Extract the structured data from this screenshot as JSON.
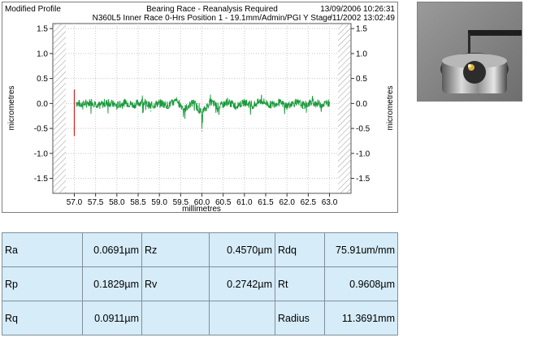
{
  "header": {
    "left": "Modified Profile",
    "center1": "Bearing Race - Reanalysis Required",
    "center2": "N360L5 Inner Race 0-Hrs Position 1 - 19.1mm/Admin/PGI Y Stage",
    "right1": "13/09/2006 10:26:31",
    "right2": "/11/2002 13:02:49"
  },
  "chart_data": {
    "type": "line",
    "title": "Bearing Race - Reanalysis Required",
    "subtitle": "N360L5 Inner Race 0-Hrs Position 1 - 19.1mm/Admin/PGI Y Stage",
    "xlabel": "millimetres",
    "ylabel": "micrometres",
    "xlim": [
      56.8,
      63.2
    ],
    "ylim": [
      -1.8,
      1.6
    ],
    "x_ticks": [
      "57.0",
      "57.5",
      "58.0",
      "58.5",
      "59.0",
      "59.5",
      "60.0",
      "60.5",
      "61.0",
      "61.5",
      "62.0",
      "62.5",
      "63.0"
    ],
    "y_ticks": [
      "1.5",
      "1.0",
      "0.5",
      "0.0",
      "-0.5",
      "-1.0",
      "-1.5"
    ],
    "grid": true,
    "series": [
      {
        "color": "#1a9a3c",
        "x": [
          57.05,
          57.2,
          57.4,
          57.6,
          57.8,
          58.0,
          58.2,
          58.4,
          58.6,
          58.8,
          59.0,
          59.2,
          59.4,
          59.6,
          59.8,
          60.0,
          60.2,
          60.4,
          60.6,
          60.8,
          61.0,
          61.2,
          61.4,
          61.6,
          61.8,
          62.0,
          62.2,
          62.4,
          62.6,
          62.8,
          63.0
        ],
        "y": [
          0.02,
          -0.05,
          0.08,
          -0.1,
          0.05,
          -0.12,
          0.06,
          -0.08,
          0.1,
          -0.15,
          0.04,
          -0.1,
          0.12,
          -0.3,
          0.06,
          -0.55,
          0.1,
          -0.2,
          0.08,
          -0.12,
          0.05,
          -0.1,
          0.15,
          -0.08,
          0.06,
          -0.12,
          0.05,
          -0.1,
          0.08,
          -0.05,
          0.03
        ]
      }
    ],
    "marker_x": 57.0,
    "marker_ylim": [
      -0.65,
      0.28
    ],
    "marker_color": "#d42020",
    "hatch_color": "#9a9a9a"
  },
  "photo": {
    "description_colors": [
      "#8a8a8a",
      "#2a2a2a",
      "#c8c8c8",
      "#e0b040"
    ]
  },
  "stats": {
    "rows": [
      [
        {
          "label": "Ra",
          "value": "0.0691µm"
        },
        {
          "label": "Rz",
          "value": "0.4570µm"
        },
        {
          "label": "Rdq",
          "value": "75.91um/mm"
        }
      ],
      [
        {
          "label": "Rp",
          "value": "0.1829µm"
        },
        {
          "label": "Rv",
          "value": "0.2742µm"
        },
        {
          "label": "Rt",
          "value": "0.9608µm"
        }
      ],
      [
        {
          "label": "Rq",
          "value": "0.0911µm"
        },
        {
          "label": "",
          "value": ""
        },
        {
          "label": "Radius",
          "value": "11.3691mm"
        }
      ]
    ]
  }
}
